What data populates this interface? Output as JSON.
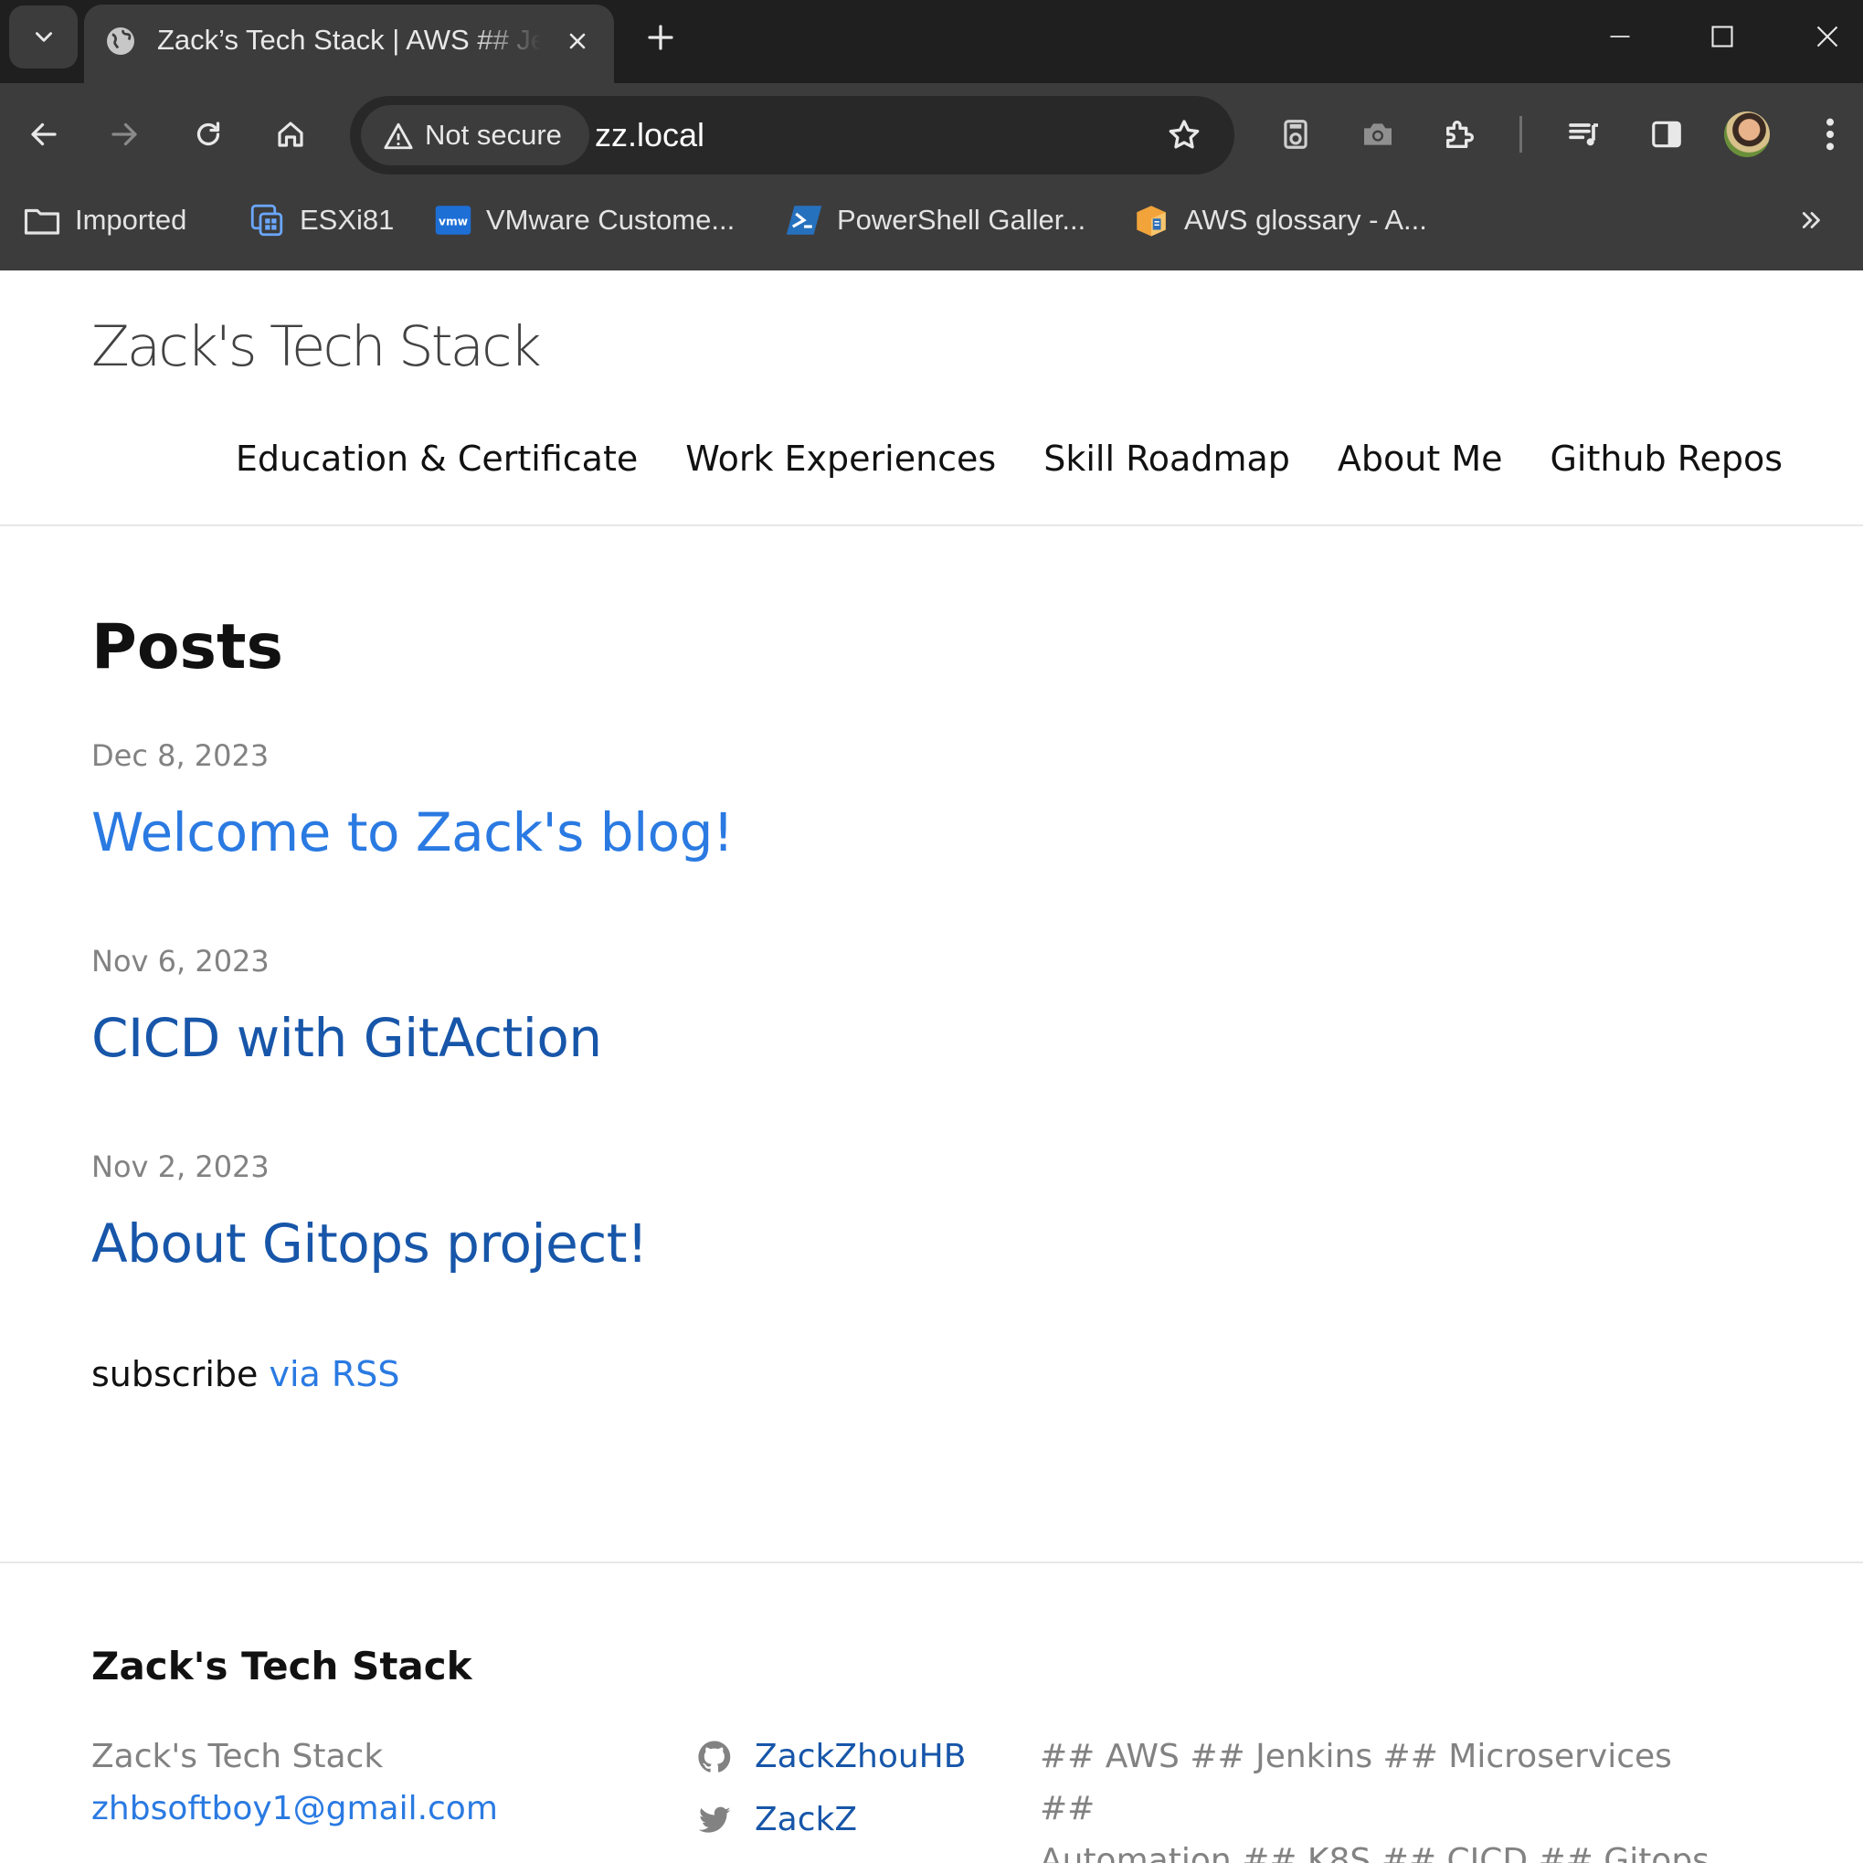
{
  "browser": {
    "tab": {
      "title": "Zack’s Tech Stack | AWS ## Je",
      "favicon": "globe-icon"
    },
    "security_label": "Not secure",
    "url": "zz.local",
    "bookmarks": [
      {
        "label": "Imported",
        "icon": "folder-icon"
      },
      {
        "label": "ESXi81",
        "icon": "esxi-icon"
      },
      {
        "label": "VMware Custome...",
        "icon": "vmware-icon"
      },
      {
        "label": "PowerShell Galler...",
        "icon": "powershell-icon"
      },
      {
        "label": "AWS glossary - A...",
        "icon": "aws-box-icon"
      }
    ]
  },
  "site": {
    "title": "Zack's Tech Stack",
    "nav": [
      "Education & Certificate",
      "Work Experiences",
      "Skill Roadmap",
      "About Me",
      "Github Repos"
    ],
    "posts_heading": "Posts",
    "posts": [
      {
        "date": "Dec 8, 2023",
        "title": "Welcome to Zack's blog!"
      },
      {
        "date": "Nov 6, 2023",
        "title": "CICD with GitAction"
      },
      {
        "date": "Nov 2, 2023",
        "title": "About Gitops project!"
      }
    ],
    "subscribe_text": "subscribe",
    "subscribe_link": "via RSS"
  },
  "footer": {
    "title": "Zack's Tech Stack",
    "name": "Zack's Tech Stack",
    "email": "zhbsoftboy1@gmail.com",
    "github": "ZackZhouHB",
    "twitter": "ZackZ",
    "description_line1": "## AWS ## Jenkins ## Microservices ##",
    "description_line2": "Automation ## K8S ## CICD ## Gitops"
  },
  "colors": {
    "link": "#2a7ae2",
    "link_visited": "#1756a9",
    "chrome_dark": "#1f1f1f",
    "chrome_toolbar": "#3c3c3c"
  }
}
